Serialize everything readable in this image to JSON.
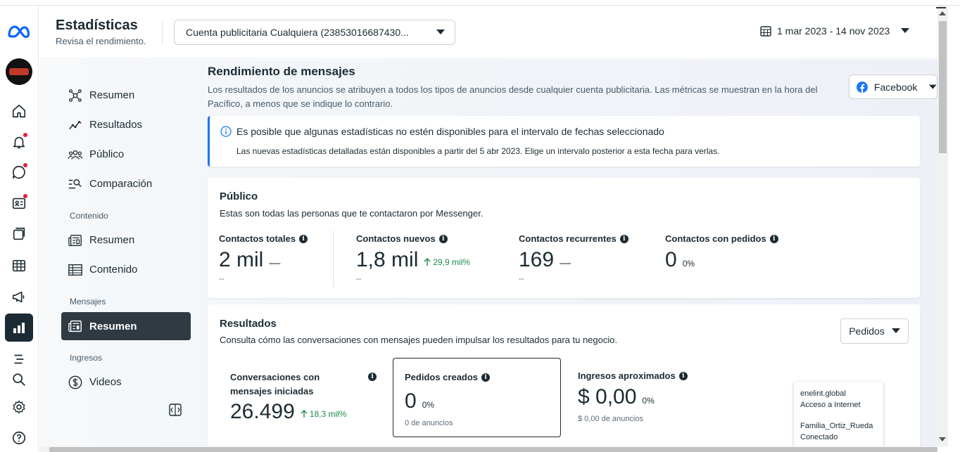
{
  "app": {
    "title": "Estadísticas",
    "subtitle": "Revisa el rendimiento."
  },
  "header": {
    "account_select": "Cuenta publicitaria Cualquiera (23853016687430...",
    "date_range": "1 mar 2023 - 14 nov 2023"
  },
  "nav": {
    "main": [
      {
        "label": "Resumen",
        "icon": "network-icon"
      },
      {
        "label": "Resultados",
        "icon": "trend-icon"
      },
      {
        "label": "Público",
        "icon": "people-icon"
      },
      {
        "label": "Comparación",
        "icon": "compare-icon"
      }
    ],
    "contenido_heading": "Contenido",
    "contenido": [
      {
        "label": "Resumen",
        "icon": "newspaper-icon"
      },
      {
        "label": "Contenido",
        "icon": "table-icon"
      }
    ],
    "mensajes_heading": "Mensajes",
    "mensajes": [
      {
        "label": "Resumen",
        "icon": "inbox-icon",
        "active": true
      }
    ],
    "ingresos_heading": "Ingresos",
    "ingresos": [
      {
        "label": "Videos",
        "icon": "dollar-icon"
      }
    ]
  },
  "page": {
    "heading": "Rendimiento de mensajes",
    "description": "Los resultados de los anuncios se atribuyen a todos los tipos de anuncios desde cualquier cuenta publicitaria. Las métricas se muestran en la hora del Pacífico, a menos que se indique lo contrario.",
    "platform_select": "Facebook"
  },
  "notice": {
    "title": "Es posible que algunas estadísticas no estén disponibles para el intervalo de fechas seleccionado",
    "body": "Las nuevas estadísticas detalladas están disponibles a partir del 5 abr 2023. Elige un intervalo posterior a esta fecha para verlas."
  },
  "publico": {
    "title": "Público",
    "description": "Estas son todas las personas que te contactaron por Messenger.",
    "metrics": [
      {
        "label": "Contactos totales",
        "value": "2 mil",
        "change": "—",
        "sub": "--"
      },
      {
        "label": "Contactos nuevos",
        "value": "1,8 mil",
        "change": "29,9 mil%",
        "sub": "--"
      },
      {
        "label": "Contactos recurrentes",
        "value": "169",
        "change": "—",
        "sub": "--"
      },
      {
        "label": "Contactos con pedidos",
        "value": "0",
        "change": "0%",
        "sub": ""
      }
    ]
  },
  "resultados": {
    "title": "Resultados",
    "description": "Consulta cómo las conversaciones con mensajes pueden impulsar los resultados para tu negocio.",
    "filter_select": "Pedidos",
    "metrics": [
      {
        "label": "Conversaciones con mensajes iniciadas",
        "value": "26.499",
        "change": "18,3 mil%"
      },
      {
        "label": "Pedidos creados",
        "value": "0",
        "change": "0%",
        "sub": "0 de anuncios"
      },
      {
        "label": "Ingresos aproximados",
        "value": "$ 0,00",
        "change": "0%",
        "sub": "$ 0,00 de anuncios"
      }
    ]
  },
  "tooltip": {
    "line1": "enelint.global",
    "line2": "Acceso a Internet",
    "line3": "Familia_Ortiz_Rueda",
    "line4": "Conectado"
  },
  "colors": {
    "meta_blue": "#0866ff",
    "accent": "#1877f2",
    "positive": "#1d8a4a",
    "active_nav": "#2f3a42",
    "rail_active": "#1c2b33"
  }
}
